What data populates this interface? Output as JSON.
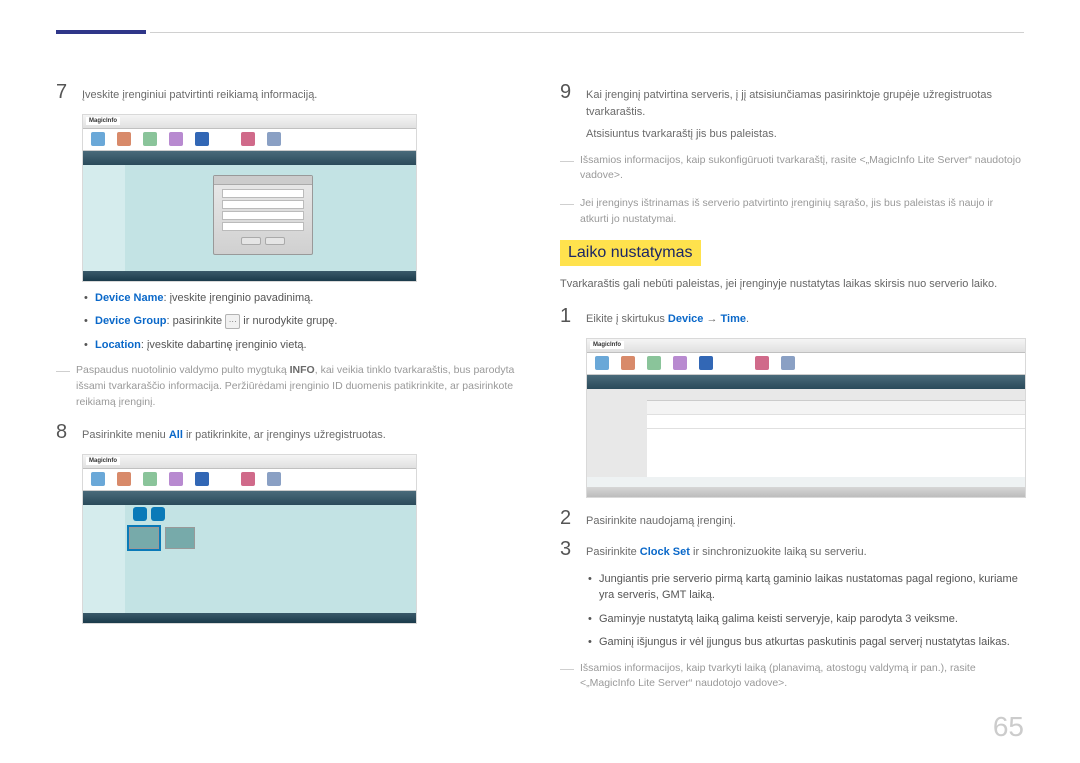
{
  "left": {
    "step7": {
      "num": "7",
      "text": "Įveskite įrenginiui patvirtinti reikiamą informaciją."
    },
    "bullet1": {
      "label": "Device Name",
      "rest": ": įveskite įrenginio pavadinimą."
    },
    "bullet2": {
      "label": "Device Group",
      "mid": ": pasirinkite ",
      "btn": "···",
      "rest": " ir nurodykite grupę."
    },
    "bullet3": {
      "label": "Location",
      "rest": ": įveskite dabartinę įrenginio vietą."
    },
    "note1": {
      "pre": "Paspaudus nuotolinio valdymo pulto mygtuką ",
      "bold": "INFO",
      "post": ", kai veikia tinklo tvarkaraštis, bus parodyta išsami tvarkaraščio informacija. Peržiūrėdami įrenginio ID duomenis patikrinkite, ar pasirinkote reikiamą įrenginį."
    },
    "step8": {
      "num": "8",
      "pre": "Pasirinkite meniu ",
      "bold": "All",
      "post": " ir patikrinkite, ar įrenginys užregistruotas."
    }
  },
  "right": {
    "step9": {
      "num": "9",
      "line1": "Kai įrenginį patvirtina serveris, į jį atsisiunčiamas pasirinktoje grupėje užregistruotas tvarkaraštis.",
      "line2": "Atsisiuntus tvarkaraštį jis bus paleistas."
    },
    "note1": "Išsamios informacijos, kaip sukonfigūruoti tvarkaraštį, rasite <„MagicInfo Lite Server“ naudotojo vadove>.",
    "note2": "Jei įrenginys ištrinamas iš serverio patvirtinto įrenginių sąrašo, jis bus paleistas iš naujo ir atkurti jo nustatymai.",
    "heading": "Laiko nustatymas",
    "intro": "Tvarkaraštis gali nebūti paleistas, jei įrenginyje nustatytas laikas skirsis nuo serverio laiko.",
    "step1": {
      "num": "1",
      "pre": "Eikite į skirtukus ",
      "dev": "Device",
      "arrow": " → ",
      "time": "Time",
      "end": "."
    },
    "step2": {
      "num": "2",
      "text": "Pasirinkite naudojamą įrenginį."
    },
    "step3": {
      "num": "3",
      "pre": "Pasirinkite ",
      "bold": "Clock Set",
      "post": " ir sinchronizuokite laiką su serveriu."
    },
    "sub1": "Jungiantis prie serverio pirmą kartą gaminio laikas nustatomas pagal regiono, kuriame yra serveris, GMT laiką.",
    "sub2": "Gaminyje nustatytą laiką galima keisti serveryje, kaip parodyta 3 veiksme.",
    "sub3": "Gaminį išjungus ir vėl įjungus bus atkurtas paskutinis pagal serverį nustatytas laikas.",
    "note3": "Išsamios informacijos, kaip tvarkyti laiką (planavimą, atostogų valdymą ir pan.), rasite <„MagicInfo Lite Server“ naudotojo vadove>."
  },
  "ss_logo": "MagicInfo",
  "pagenum": "65"
}
